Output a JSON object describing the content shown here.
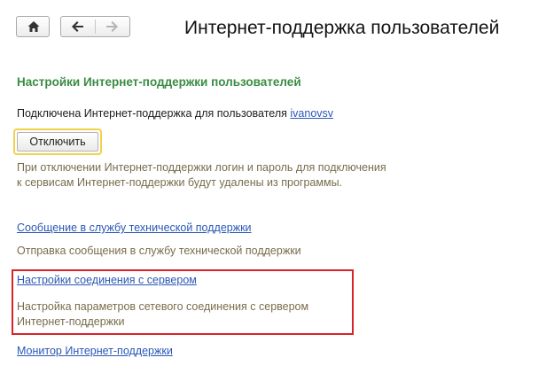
{
  "window": {
    "title": "Интернет-поддержка пользователей"
  },
  "toolbar": {
    "home_icon": "home-icon",
    "back_icon": "arrow-left-icon",
    "forward_icon": "arrow-right-icon"
  },
  "settings": {
    "heading": "Настройки Интернет-поддержки пользователей",
    "connected_text": "Подключена Интернет-поддержка для пользователя",
    "username": "ivanovsv",
    "disconnect_label": "Отключить",
    "disconnect_hint_line1": "При отключении Интернет-поддержки логин и пароль для подключения",
    "disconnect_hint_line2": "к сервисам Интернет-поддержки будут удалены из программы."
  },
  "links": {
    "support_message": {
      "label": "Сообщение в службу технической поддержки",
      "description": "Отправка сообщения в службу технической поддержки"
    },
    "server_connection": {
      "label": "Настройки соединения с сервером",
      "description_line1": "Настройка параметров сетевого соединения с сервером",
      "description_line2": "Интернет-поддержки"
    },
    "monitor": {
      "label": "Монитор Интернет-поддержки"
    }
  },
  "colors": {
    "heading_green": "#3a8c43",
    "link_blue": "#2a58b5",
    "hint_brown": "#7a6c4c",
    "focus_yellow": "#f2d24a",
    "highlight_red": "#d8232a"
  }
}
